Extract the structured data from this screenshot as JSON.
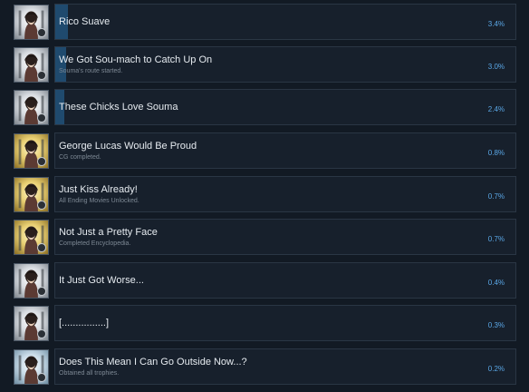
{
  "achievements": [
    {
      "title": "Rico Suave",
      "desc": "",
      "percent": "3.4%",
      "fill": 0.034,
      "bg": "silver"
    },
    {
      "title": "We Got Sou-mach to Catch Up On",
      "desc": "Souma's route started.",
      "percent": "3.0%",
      "fill": 0.03,
      "bg": "silver"
    },
    {
      "title": "These Chicks Love Souma",
      "desc": "",
      "percent": "2.4%",
      "fill": 0.024,
      "bg": "silver"
    },
    {
      "title": "George Lucas Would Be Proud",
      "desc": "CG completed.",
      "percent": "0.8%",
      "fill": 0.0,
      "bg": "gold"
    },
    {
      "title": "Just Kiss Already!",
      "desc": "All Ending Movies Unlocked.",
      "percent": "0.7%",
      "fill": 0.0,
      "bg": "gold"
    },
    {
      "title": "Not Just a Pretty Face",
      "desc": "Completed Encyclopedia.",
      "percent": "0.7%",
      "fill": 0.0,
      "bg": "gold"
    },
    {
      "title": "It Just Got Worse...",
      "desc": "",
      "percent": "0.4%",
      "fill": 0.0,
      "bg": "silver"
    },
    {
      "title": "[................]",
      "desc": "",
      "percent": "0.3%",
      "fill": 0.0,
      "bg": "silver"
    },
    {
      "title": "Does This Mean I Can Go Outside Now...?",
      "desc": "Obtained all trophies.",
      "percent": "0.2%",
      "fill": 0.0,
      "bg": "platinum"
    }
  ]
}
